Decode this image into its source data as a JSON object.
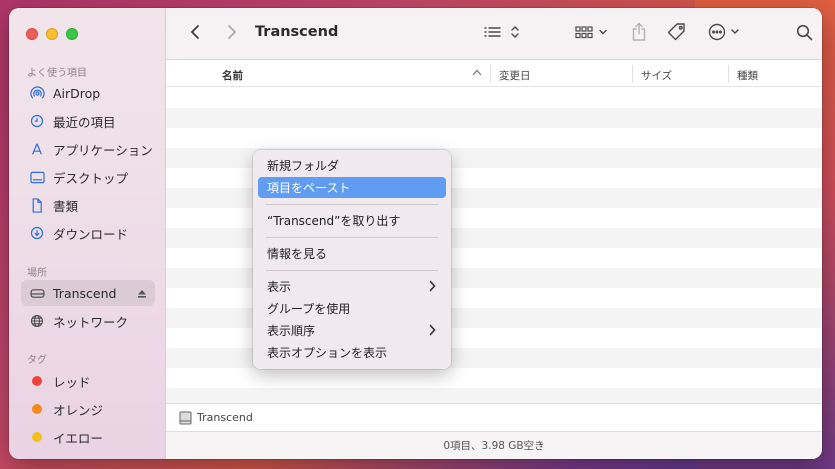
{
  "window": {
    "title": "Transcend"
  },
  "sidebar": {
    "favorites_header": "よく使う項目",
    "favorites": [
      {
        "label": "AirDrop",
        "icon": "airdrop-icon"
      },
      {
        "label": "最近の項目",
        "icon": "clock-icon"
      },
      {
        "label": "アプリケーション",
        "icon": "applications-icon"
      },
      {
        "label": "デスクトップ",
        "icon": "desktop-icon"
      },
      {
        "label": "書類",
        "icon": "document-icon"
      },
      {
        "label": "ダウンロード",
        "icon": "download-icon"
      }
    ],
    "locations_header": "場所",
    "locations": [
      {
        "label": "Transcend",
        "icon": "drive-icon",
        "selected": true
      },
      {
        "label": "ネットワーク",
        "icon": "network-icon"
      }
    ],
    "tags_header": "タグ",
    "tags": [
      {
        "label": "レッド",
        "color": "#f0443a"
      },
      {
        "label": "オレンジ",
        "color": "#f5891c"
      },
      {
        "label": "イエロー",
        "color": "#f2bf1f"
      }
    ]
  },
  "toolbar": {
    "title": "Transcend",
    "icons": [
      "back-icon",
      "forward-icon",
      "list-view-icon",
      "group-icon",
      "share-icon",
      "tag-icon",
      "more-icon",
      "search-icon"
    ]
  },
  "columns": {
    "name": "名前",
    "modified": "変更日",
    "size": "サイズ",
    "kind": "種類"
  },
  "context_menu": {
    "items": [
      {
        "label": "新規フォルダ"
      },
      {
        "label": "項目をペースト",
        "highlighted": true
      },
      {
        "label": "“Transcend”を取り出す"
      },
      {
        "label": "情報を見る"
      },
      {
        "label": "表示",
        "submenu": true
      },
      {
        "label": "グループを使用"
      },
      {
        "label": "表示順序",
        "submenu": true
      },
      {
        "label": "表示オプションを表示"
      }
    ]
  },
  "pathbar": {
    "label": "Transcend"
  },
  "statusbar": {
    "text": "0項目、3.98 GB空き"
  }
}
